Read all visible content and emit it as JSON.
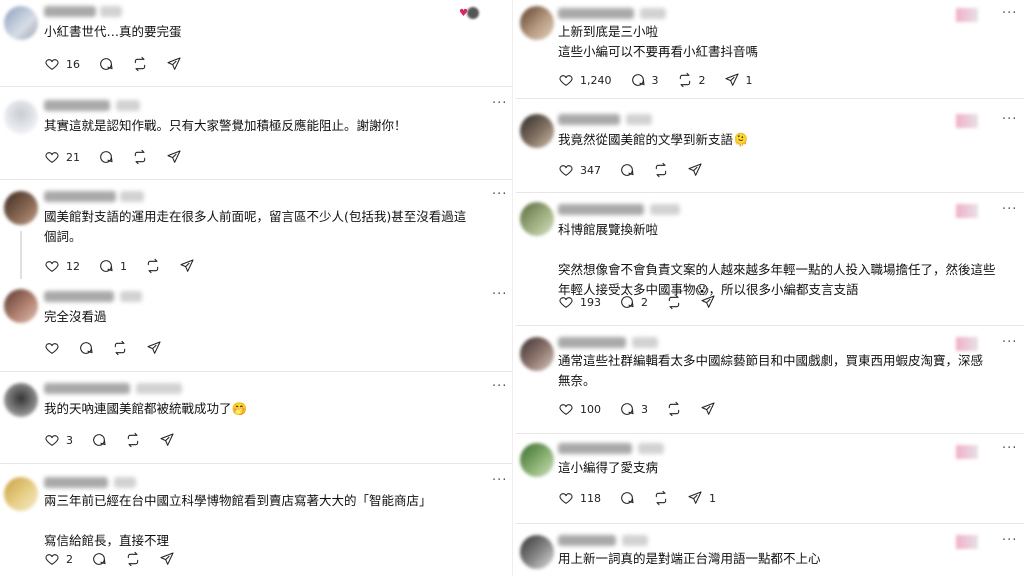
{
  "colors": {
    "divider": "#e6e6e6",
    "text": "#111111",
    "badge": "#e88aa8"
  },
  "icons": {
    "like": "heart-icon",
    "reply": "comment-icon",
    "repost": "repost-icon",
    "share": "send-icon",
    "more": "more-icon"
  },
  "left_comments": [
    {
      "text": "小紅書世代…真的要完蛋",
      "likes": "16",
      "replies": "",
      "reposts": ""
    },
    {
      "text": "其實這就是認知作戰。只有大家警覺加積極反應能阻止。謝謝你！",
      "likes": "21",
      "replies": "",
      "reposts": ""
    },
    {
      "text": "國美館對支語的運用走在很多人前面呢，留言區不少人(包括我)甚至沒看過這\n個詞。",
      "likes": "12",
      "replies": "1",
      "reposts": ""
    },
    {
      "text": "完全沒看過",
      "likes": "",
      "replies": "",
      "reposts": ""
    },
    {
      "text": "我的天吶連國美館都被統戰成功了🤭",
      "likes": "3",
      "replies": "",
      "reposts": ""
    },
    {
      "text": "兩三年前已經在台中國立科學博物館看到賣店寫著大大的「智能商店」\n\n寫信給館長，直接不理",
      "likes": "2",
      "replies": "",
      "reposts": ""
    }
  ],
  "right_comments": [
    {
      "text": "上新到底是三小啦\n這些小編可以不要再看小紅書抖音嗎",
      "likes": "1,240",
      "replies": "3",
      "reposts": "2",
      "shares": "1"
    },
    {
      "text": "我竟然從國美館的文學到新支語🫠",
      "likes": "347",
      "replies": "",
      "reposts": "",
      "shares": ""
    },
    {
      "text": "科博館展覽換新啦\n\n突然想像會不會負責文案的人越來越多年輕一點的人投入職場擔任了，然後這些\n年輕人接受太多中國事物😱，所以很多小編都支言支語",
      "likes": "193",
      "replies": "2",
      "reposts": "",
      "shares": ""
    },
    {
      "text": "通常這些社群編輯看太多中國綜藝節目和中國戲劇，買東西用蝦皮淘寶，深感\n無奈。",
      "likes": "100",
      "replies": "3",
      "reposts": "",
      "shares": ""
    },
    {
      "text": "這小編得了愛支病",
      "likes": "118",
      "replies": "",
      "reposts": "",
      "shares": "1"
    },
    {
      "text": "用上新一詞真的是對端正台灣用語一點都不上心",
      "likes": "",
      "replies": "",
      "reposts": "",
      "shares": ""
    }
  ]
}
